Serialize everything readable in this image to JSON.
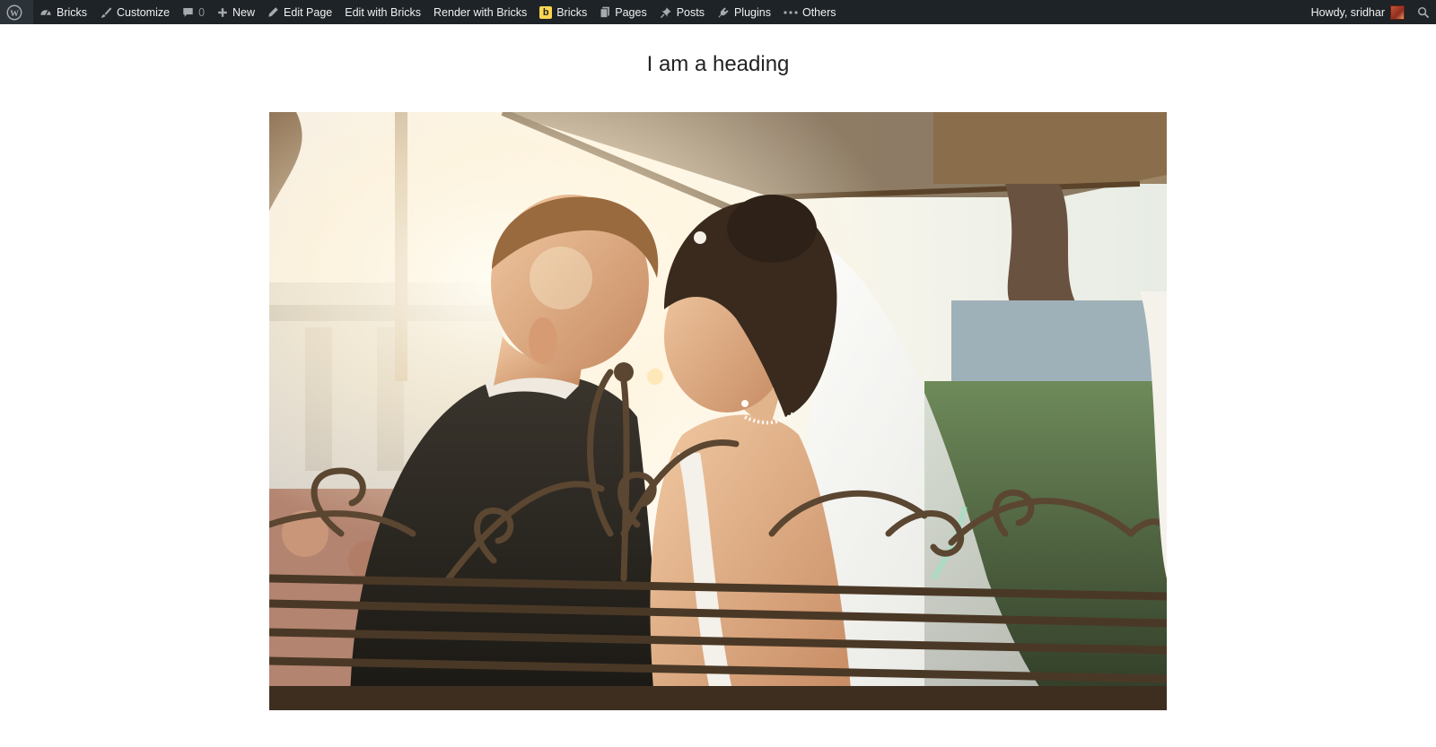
{
  "adminbar": {
    "items": [
      {
        "label": "Bricks"
      },
      {
        "label": "Customize"
      },
      {
        "label": "0"
      },
      {
        "label": "New"
      },
      {
        "label": "Edit Page"
      },
      {
        "label": "Edit with Bricks"
      },
      {
        "label": "Render with Bricks"
      },
      {
        "label": "Bricks"
      },
      {
        "label": "Pages"
      },
      {
        "label": "Posts"
      },
      {
        "label": "Plugins"
      },
      {
        "label": "Others"
      }
    ],
    "greeting": "Howdy, sridhar",
    "icons": {
      "wordpress": "wordpress-logo-icon",
      "site": "dashboard-icon",
      "customize": "paintbrush-icon",
      "comments": "comment-bubble-icon",
      "new": "plus-icon",
      "edit": "pencil-icon",
      "bricks": "bricks-b-icon",
      "pages": "pages-icon",
      "posts": "pushpin-icon",
      "plugins": "plug-icon",
      "others": "ellipsis-icon",
      "search": "search-icon"
    },
    "colors": {
      "bar": "#1d2327",
      "text": "#f0f0f1",
      "bricks_accent": "#ffd64f"
    }
  },
  "page": {
    "heading": "I am a heading"
  }
}
